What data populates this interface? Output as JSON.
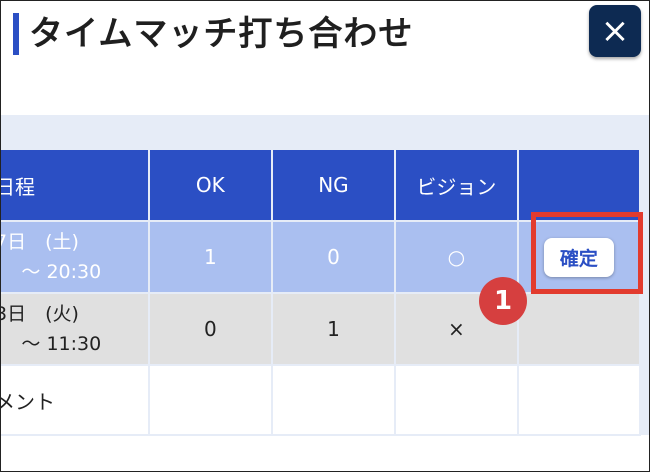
{
  "header": {
    "title": "タイムマッチ打ち合わせ",
    "close_label": "×"
  },
  "table": {
    "columns": [
      "日程",
      "OK",
      "NG",
      "ビジョン",
      ""
    ],
    "rows": [
      {
        "date_line1": "7日　(土)",
        "date_line2": ")　〜 20:30",
        "ok": "1",
        "ng": "0",
        "vision": "○",
        "action_label": "確定"
      },
      {
        "date_line1": "3日　(火)",
        "date_line2": ")　〜 11:30",
        "ok": "0",
        "ng": "1",
        "vision": "×",
        "action_label": ""
      }
    ],
    "comment_label": "メント"
  },
  "annotation": {
    "step_number": "1",
    "highlight_color": "#e23b2e",
    "badge_color": "#d63f3f"
  },
  "colors": {
    "header_blue": "#2b4fc4",
    "selected_row": "#aabff0",
    "close_button": "#0d2a52"
  }
}
